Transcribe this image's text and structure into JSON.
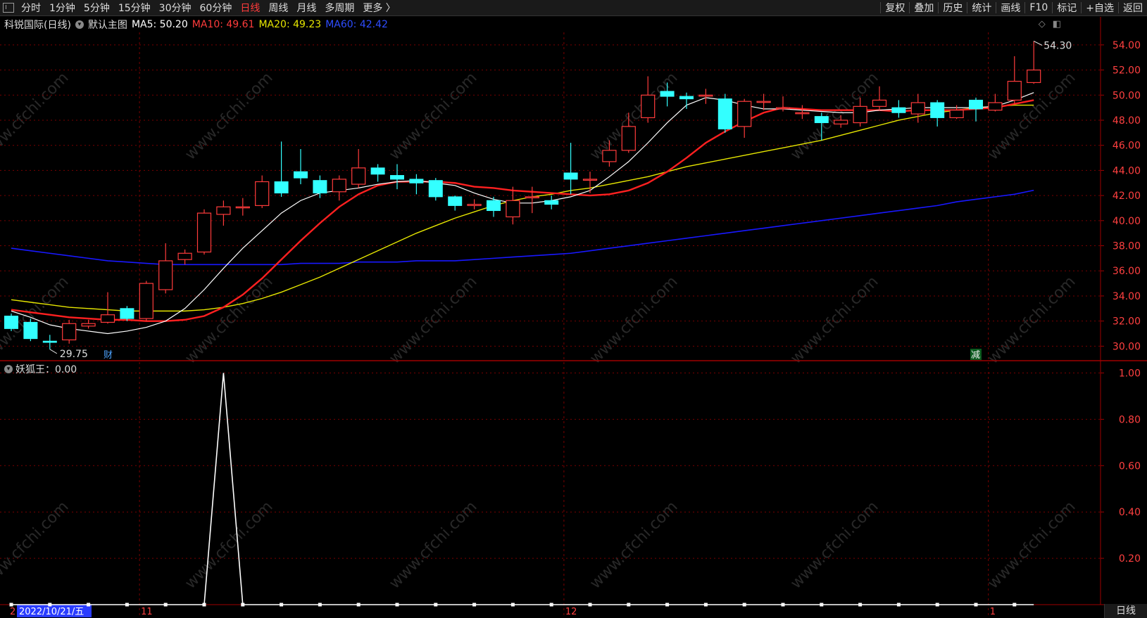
{
  "topbar": {
    "left": [
      "分时",
      "1分钟",
      "5分钟",
      "15分钟",
      "30分钟",
      "60分钟",
      "日线",
      "周线",
      "月线",
      "多周期",
      "更多 〉"
    ],
    "active": "日线",
    "right": [
      "复权",
      "叠加",
      "历史",
      "统计",
      "画线",
      "F10",
      "标记",
      "+自选",
      "返回"
    ]
  },
  "info": {
    "stock": "科锐国际(日线)",
    "template": "默认主图",
    "ma5": "MA5: 50.20",
    "ma10": "MA10: 49.61",
    "ma20": "MA20: 49.23",
    "ma60": "MA60: 42.42"
  },
  "indicator": {
    "label": "妖狐王：0.00"
  },
  "annotations": {
    "high": "54.30",
    "low": "29.75",
    "badge_cai": "财",
    "badge_jian": "减"
  },
  "axis": {
    "price_ticks": [
      "54.00",
      "52.00",
      "50.00",
      "48.00",
      "46.00",
      "44.00",
      "42.00",
      "40.00",
      "38.00",
      "36.00",
      "34.00",
      "32.00",
      "30.00"
    ],
    "ind_ticks": [
      "1.00",
      "0.80",
      "0.60",
      "0.40",
      "0.20"
    ],
    "date_labels": {
      "first": "2022/10/21/五",
      "start_digit": "2",
      "nov": "11",
      "dec": "12",
      "jan": "1"
    }
  },
  "watermark": "www.cfchi.com",
  "bottom_tab": "日线",
  "colors": {
    "up": "#ff3b3b",
    "down": "#33ffff",
    "ma5": "#ffffff",
    "ma10": "#ff2020",
    "ma20": "#e6e600",
    "ma60": "#1818ff",
    "grid": "#7a0000"
  },
  "chart_data": {
    "type": "candlestick",
    "candles": [
      {
        "o": 32.4,
        "c": 31.4,
        "h": 32.6,
        "l": 31.2
      },
      {
        "o": 31.9,
        "c": 30.6,
        "h": 32.2,
        "l": 30.4
      },
      {
        "o": 30.4,
        "c": 30.3,
        "h": 30.9,
        "l": 29.75
      },
      {
        "o": 30.5,
        "c": 31.8,
        "h": 32.1,
        "l": 30.2
      },
      {
        "o": 31.6,
        "c": 31.8,
        "h": 32.1,
        "l": 31.4
      },
      {
        "o": 31.9,
        "c": 32.5,
        "h": 34.3,
        "l": 31.8
      },
      {
        "o": 33.0,
        "c": 32.2,
        "h": 33.2,
        "l": 32.0
      },
      {
        "o": 32.2,
        "c": 35.0,
        "h": 35.2,
        "l": 32.0
      },
      {
        "o": 34.5,
        "c": 36.8,
        "h": 38.2,
        "l": 34.2
      },
      {
        "o": 36.9,
        "c": 37.4,
        "h": 37.7,
        "l": 36.5
      },
      {
        "o": 37.5,
        "c": 40.6,
        "h": 40.9,
        "l": 37.3
      },
      {
        "o": 40.5,
        "c": 41.1,
        "h": 41.6,
        "l": 39.6
      },
      {
        "o": 41.1,
        "c": 41.1,
        "h": 41.8,
        "l": 40.4
      },
      {
        "o": 41.2,
        "c": 43.1,
        "h": 43.6,
        "l": 41.0
      },
      {
        "o": 43.1,
        "c": 42.2,
        "h": 46.3,
        "l": 41.9
      },
      {
        "o": 43.9,
        "c": 43.4,
        "h": 45.7,
        "l": 42.9
      },
      {
        "o": 43.2,
        "c": 42.2,
        "h": 43.6,
        "l": 41.8
      },
      {
        "o": 42.3,
        "c": 43.3,
        "h": 43.6,
        "l": 41.6
      },
      {
        "o": 42.9,
        "c": 44.2,
        "h": 45.7,
        "l": 42.6
      },
      {
        "o": 44.2,
        "c": 43.7,
        "h": 44.5,
        "l": 43.1
      },
      {
        "o": 43.6,
        "c": 43.3,
        "h": 44.5,
        "l": 42.5
      },
      {
        "o": 43.3,
        "c": 43.0,
        "h": 43.7,
        "l": 42.1
      },
      {
        "o": 43.2,
        "c": 41.9,
        "h": 43.4,
        "l": 41.6
      },
      {
        "o": 41.9,
        "c": 41.2,
        "h": 42.0,
        "l": 40.8
      },
      {
        "o": 41.2,
        "c": 41.3,
        "h": 41.7,
        "l": 40.9
      },
      {
        "o": 41.6,
        "c": 40.8,
        "h": 41.9,
        "l": 40.3
      },
      {
        "o": 40.3,
        "c": 41.6,
        "h": 42.7,
        "l": 39.7
      },
      {
        "o": 41.9,
        "c": 41.9,
        "h": 42.7,
        "l": 40.6
      },
      {
        "o": 41.6,
        "c": 41.3,
        "h": 42.0,
        "l": 40.9
      },
      {
        "o": 43.8,
        "c": 43.3,
        "h": 46.2,
        "l": 42.1
      },
      {
        "o": 43.3,
        "c": 43.3,
        "h": 43.9,
        "l": 42.2
      },
      {
        "o": 44.7,
        "c": 45.6,
        "h": 46.4,
        "l": 44.3
      },
      {
        "o": 45.6,
        "c": 47.5,
        "h": 48.6,
        "l": 45.4
      },
      {
        "o": 48.2,
        "c": 50.0,
        "h": 51.5,
        "l": 47.8
      },
      {
        "o": 50.3,
        "c": 49.9,
        "h": 51.0,
        "l": 49.1
      },
      {
        "o": 49.9,
        "c": 49.7,
        "h": 50.2,
        "l": 48.9
      },
      {
        "o": 50.0,
        "c": 50.0,
        "h": 50.5,
        "l": 49.3
      },
      {
        "o": 49.7,
        "c": 47.3,
        "h": 50.1,
        "l": 47.0
      },
      {
        "o": 47.5,
        "c": 49.5,
        "h": 49.7,
        "l": 46.6
      },
      {
        "o": 49.5,
        "c": 49.5,
        "h": 50.1,
        "l": 48.8
      },
      {
        "o": 49.0,
        "c": 49.0,
        "h": 49.9,
        "l": 48.7
      },
      {
        "o": 48.6,
        "c": 48.6,
        "h": 49.2,
        "l": 48.1
      },
      {
        "o": 48.3,
        "c": 47.8,
        "h": 48.6,
        "l": 46.4
      },
      {
        "o": 47.7,
        "c": 48.0,
        "h": 48.4,
        "l": 47.4
      },
      {
        "o": 47.8,
        "c": 49.1,
        "h": 49.8,
        "l": 47.5
      },
      {
        "o": 49.1,
        "c": 49.6,
        "h": 50.7,
        "l": 48.8
      },
      {
        "o": 49.0,
        "c": 48.6,
        "h": 49.6,
        "l": 48.2
      },
      {
        "o": 48.5,
        "c": 49.4,
        "h": 50.1,
        "l": 47.8
      },
      {
        "o": 49.4,
        "c": 48.2,
        "h": 49.6,
        "l": 47.5
      },
      {
        "o": 48.2,
        "c": 48.8,
        "h": 49.2,
        "l": 48.1
      },
      {
        "o": 49.6,
        "c": 48.9,
        "h": 49.8,
        "l": 47.9
      },
      {
        "o": 48.8,
        "c": 49.4,
        "h": 50.1,
        "l": 48.7
      },
      {
        "o": 49.6,
        "c": 51.1,
        "h": 53.1,
        "l": 49.3
      },
      {
        "o": 51.0,
        "c": 52.0,
        "h": 54.3,
        "l": 50.9
      }
    ],
    "ma5": [
      32.8,
      32.3,
      31.7,
      31.4,
      31.2,
      31.0,
      31.2,
      31.5,
      32.0,
      33.0,
      34.5,
      36.2,
      37.8,
      39.2,
      40.6,
      41.6,
      42.2,
      42.4,
      42.6,
      42.9,
      43.1,
      43.2,
      43.0,
      42.8,
      42.2,
      41.7,
      41.4,
      41.4,
      41.6,
      41.9,
      42.4,
      43.5,
      44.7,
      46.2,
      47.8,
      49.2,
      49.8,
      49.6,
      49.2,
      48.9,
      48.9,
      48.8,
      48.7,
      48.6,
      48.6,
      48.8,
      48.9,
      49.0,
      49.0,
      49.0,
      49.0,
      49.1,
      49.6,
      50.2
    ],
    "ma10": [
      32.9,
      32.7,
      32.5,
      32.3,
      32.2,
      32.1,
      32.1,
      32.0,
      32.0,
      32.1,
      32.4,
      33.1,
      34.1,
      35.4,
      36.9,
      38.4,
      39.8,
      41.1,
      42.1,
      42.8,
      43.1,
      43.1,
      43.1,
      43.0,
      42.7,
      42.6,
      42.4,
      42.3,
      42.2,
      42.1,
      42.0,
      42.1,
      42.4,
      43.0,
      43.9,
      45.0,
      46.2,
      47.1,
      47.9,
      48.6,
      49.0,
      48.9,
      48.8,
      48.8,
      48.8,
      48.8,
      48.7,
      48.8,
      48.8,
      48.8,
      48.9,
      49.0,
      49.3,
      49.6
    ],
    "ma20": [
      33.7,
      33.5,
      33.3,
      33.1,
      33.0,
      32.9,
      32.8,
      32.8,
      32.8,
      32.8,
      32.9,
      33.1,
      33.4,
      33.8,
      34.3,
      34.9,
      35.5,
      36.2,
      36.9,
      37.6,
      38.3,
      39.0,
      39.6,
      40.2,
      40.7,
      41.2,
      41.6,
      41.9,
      42.1,
      42.4,
      42.6,
      42.9,
      43.2,
      43.5,
      43.9,
      44.3,
      44.6,
      44.9,
      45.2,
      45.5,
      45.8,
      46.1,
      46.4,
      46.8,
      47.2,
      47.6,
      48.0,
      48.3,
      48.6,
      48.8,
      49.0,
      49.1,
      49.2,
      49.2
    ],
    "ma60": [
      37.8,
      37.6,
      37.4,
      37.2,
      37.0,
      36.8,
      36.7,
      36.6,
      36.5,
      36.5,
      36.5,
      36.5,
      36.5,
      36.5,
      36.5,
      36.6,
      36.6,
      36.6,
      36.7,
      36.7,
      36.7,
      36.8,
      36.8,
      36.8,
      36.9,
      37.0,
      37.1,
      37.2,
      37.3,
      37.4,
      37.6,
      37.8,
      38.0,
      38.2,
      38.4,
      38.6,
      38.8,
      39.0,
      39.2,
      39.4,
      39.6,
      39.8,
      40.0,
      40.2,
      40.4,
      40.6,
      40.8,
      41.0,
      41.2,
      41.5,
      41.7,
      41.9,
      42.1,
      42.42
    ],
    "indicator": [
      0,
      0,
      0,
      0,
      0,
      0,
      0,
      0,
      0,
      0,
      0,
      1,
      0,
      0,
      0,
      0,
      0,
      0,
      0,
      0,
      0,
      0,
      0,
      0,
      0,
      0,
      0,
      0,
      0,
      0,
      0,
      0,
      0,
      0,
      0,
      0,
      0,
      0,
      0,
      0,
      0,
      0,
      0,
      0,
      0,
      0,
      0,
      0,
      0,
      0,
      0,
      0,
      0,
      0
    ],
    "price_range": [
      28.9,
      55.0
    ],
    "ind_range": [
      0,
      1.05
    ]
  }
}
